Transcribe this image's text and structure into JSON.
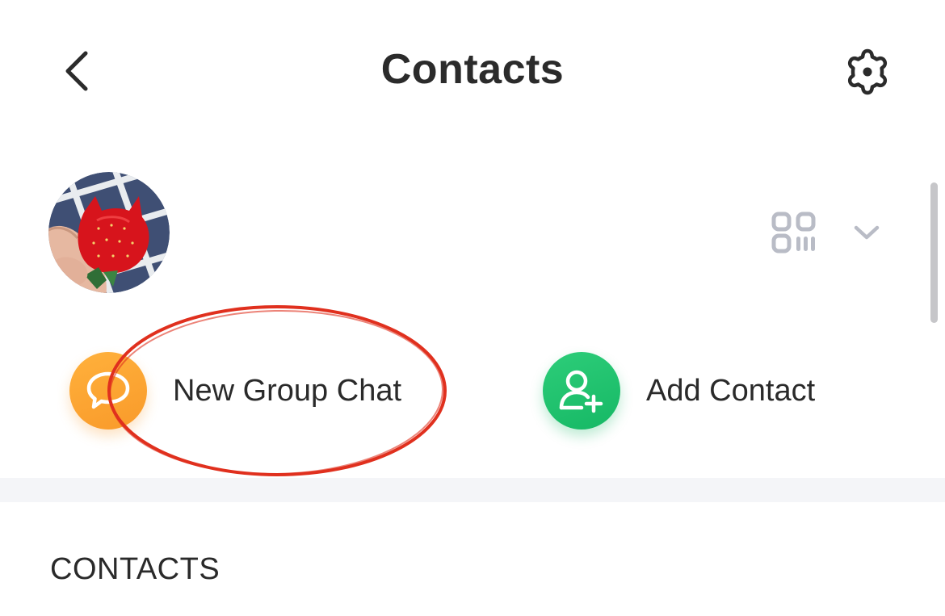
{
  "header": {
    "title": "Contacts",
    "back_icon": "chevron-left-icon",
    "settings_icon": "gear-icon"
  },
  "profile": {
    "avatar_description": "avatar",
    "qr_icon": "qr-code-icon",
    "expand_icon": "chevron-down-icon"
  },
  "actions": [
    {
      "label": "New Group Chat",
      "icon": "chat-bubble-icon",
      "color": "#f99a2a"
    },
    {
      "label": "Add Contact",
      "icon": "add-user-icon",
      "color": "#16b865"
    }
  ],
  "annotation": {
    "color": "#e0301e"
  },
  "sections": {
    "contacts_header": "CONTACTS"
  },
  "colors": {
    "background": "#ffffff",
    "divider_band": "#f4f5f8",
    "icon_gray": "#b9bcc6"
  }
}
